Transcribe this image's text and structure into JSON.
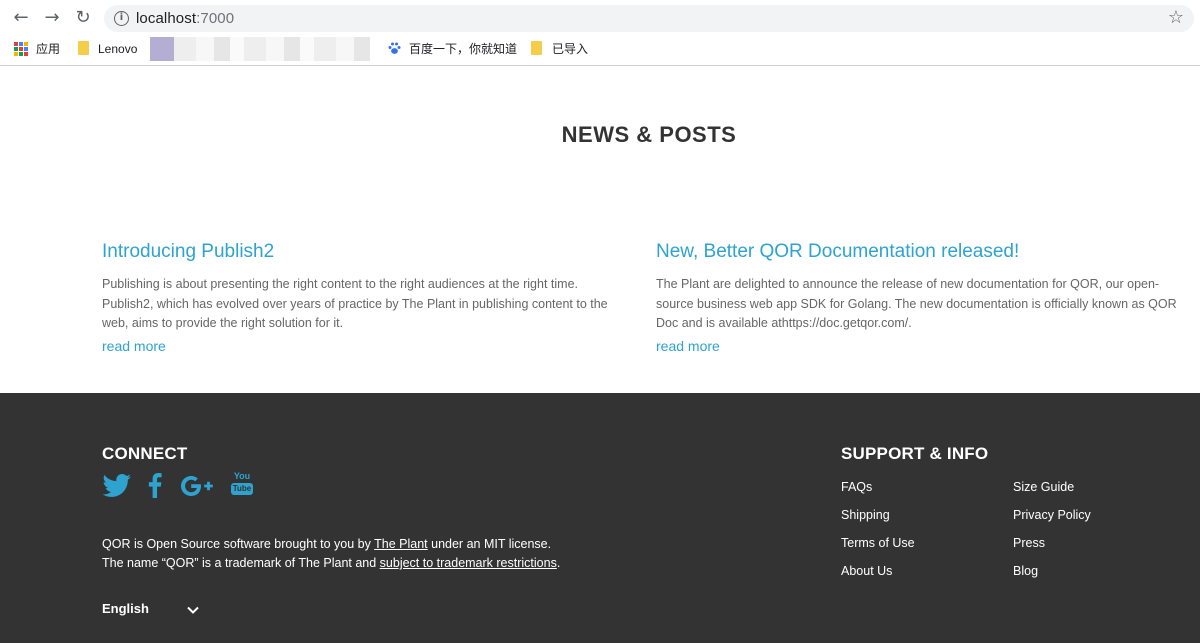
{
  "browser": {
    "url_host": "localhost",
    "url_port": ":7000",
    "bookmarks": [
      {
        "label": "应用",
        "icon": "apps-grid-icon"
      },
      {
        "label": "Lenovo",
        "icon": "folder-icon"
      },
      {
        "label": "百度一下，你就知道",
        "icon": "baidu-paw-icon"
      },
      {
        "label": "已导入",
        "icon": "folder-icon"
      }
    ]
  },
  "news": {
    "title": "NEWS & POSTS",
    "posts": [
      {
        "title": "Introducing Publish2",
        "lines": [
          "Publishing is about presenting the right content to the right audiences at the right time.",
          "Publish2, which has evolved over years of practice by The Plant in publishing content to the",
          "web, aims to provide the right solution for it."
        ],
        "read_more": "read more"
      },
      {
        "title": "New, Better QOR Documentation released!",
        "lines": [
          "The Plant are delighted to announce the release of new documentation for QOR, our open-",
          "source business web app SDK for Golang. The new documentation is officially known as QOR",
          "Doc and is available athttps://doc.getqor.com/."
        ],
        "read_more": "read more"
      }
    ]
  },
  "footer": {
    "connect_title": "CONNECT",
    "social_icons": [
      "twitter-icon",
      "facebook-icon",
      "google-plus-icon",
      "youtube-icon"
    ],
    "youtube_text_top": "You",
    "youtube_text_bottom": "Tube",
    "legal": {
      "line1_pre": "QOR is Open Source software brought to you by ",
      "line1_link": "The Plant",
      "line1_post": " under an MIT license.",
      "line2_pre": "The name “QOR” is a trademark of The Plant and ",
      "line2_link": "subject to trademark restrictions",
      "line2_post": "."
    },
    "language": "English",
    "support_title": "SUPPORT & INFO",
    "links_col1": [
      "FAQs",
      "Shipping",
      "Terms of Use",
      "About Us"
    ],
    "links_col2": [
      "Size Guide",
      "Privacy Policy",
      "Press",
      "Blog"
    ]
  },
  "colors": {
    "link_blue": "#2ea3cf",
    "footer_bg": "#333333",
    "social_blue": "#2ea3cf"
  }
}
